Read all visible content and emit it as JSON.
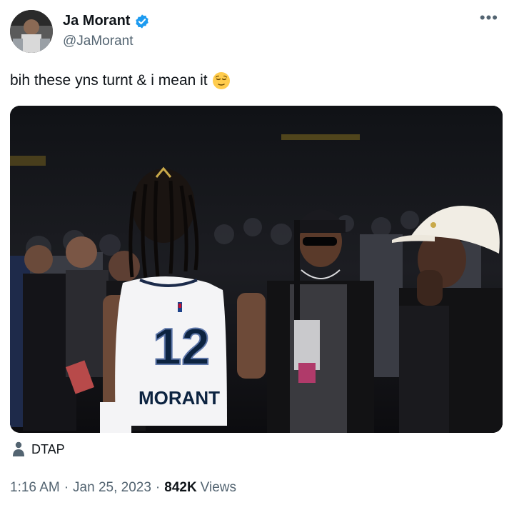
{
  "author": {
    "name": "Ja Morant",
    "handle": "@JaMorant",
    "verified": true
  },
  "menu_icon": "more-horizontal-icon",
  "tweet": {
    "text": "bih these yns turnt & i mean it",
    "emoji": "relieved-face-emoji"
  },
  "media": {
    "jersey_number": "12",
    "jersey_name": "MORANT"
  },
  "location": {
    "icon": "person-icon",
    "label": "DTAP"
  },
  "meta": {
    "time": "1:16 AM",
    "separator": "·",
    "date": "Jan 25, 2023",
    "views_count": "842K",
    "views_label": "Views"
  },
  "colors": {
    "text_primary": "#0f1419",
    "text_secondary": "#536471",
    "verified_blue": "#1d9bf0"
  }
}
